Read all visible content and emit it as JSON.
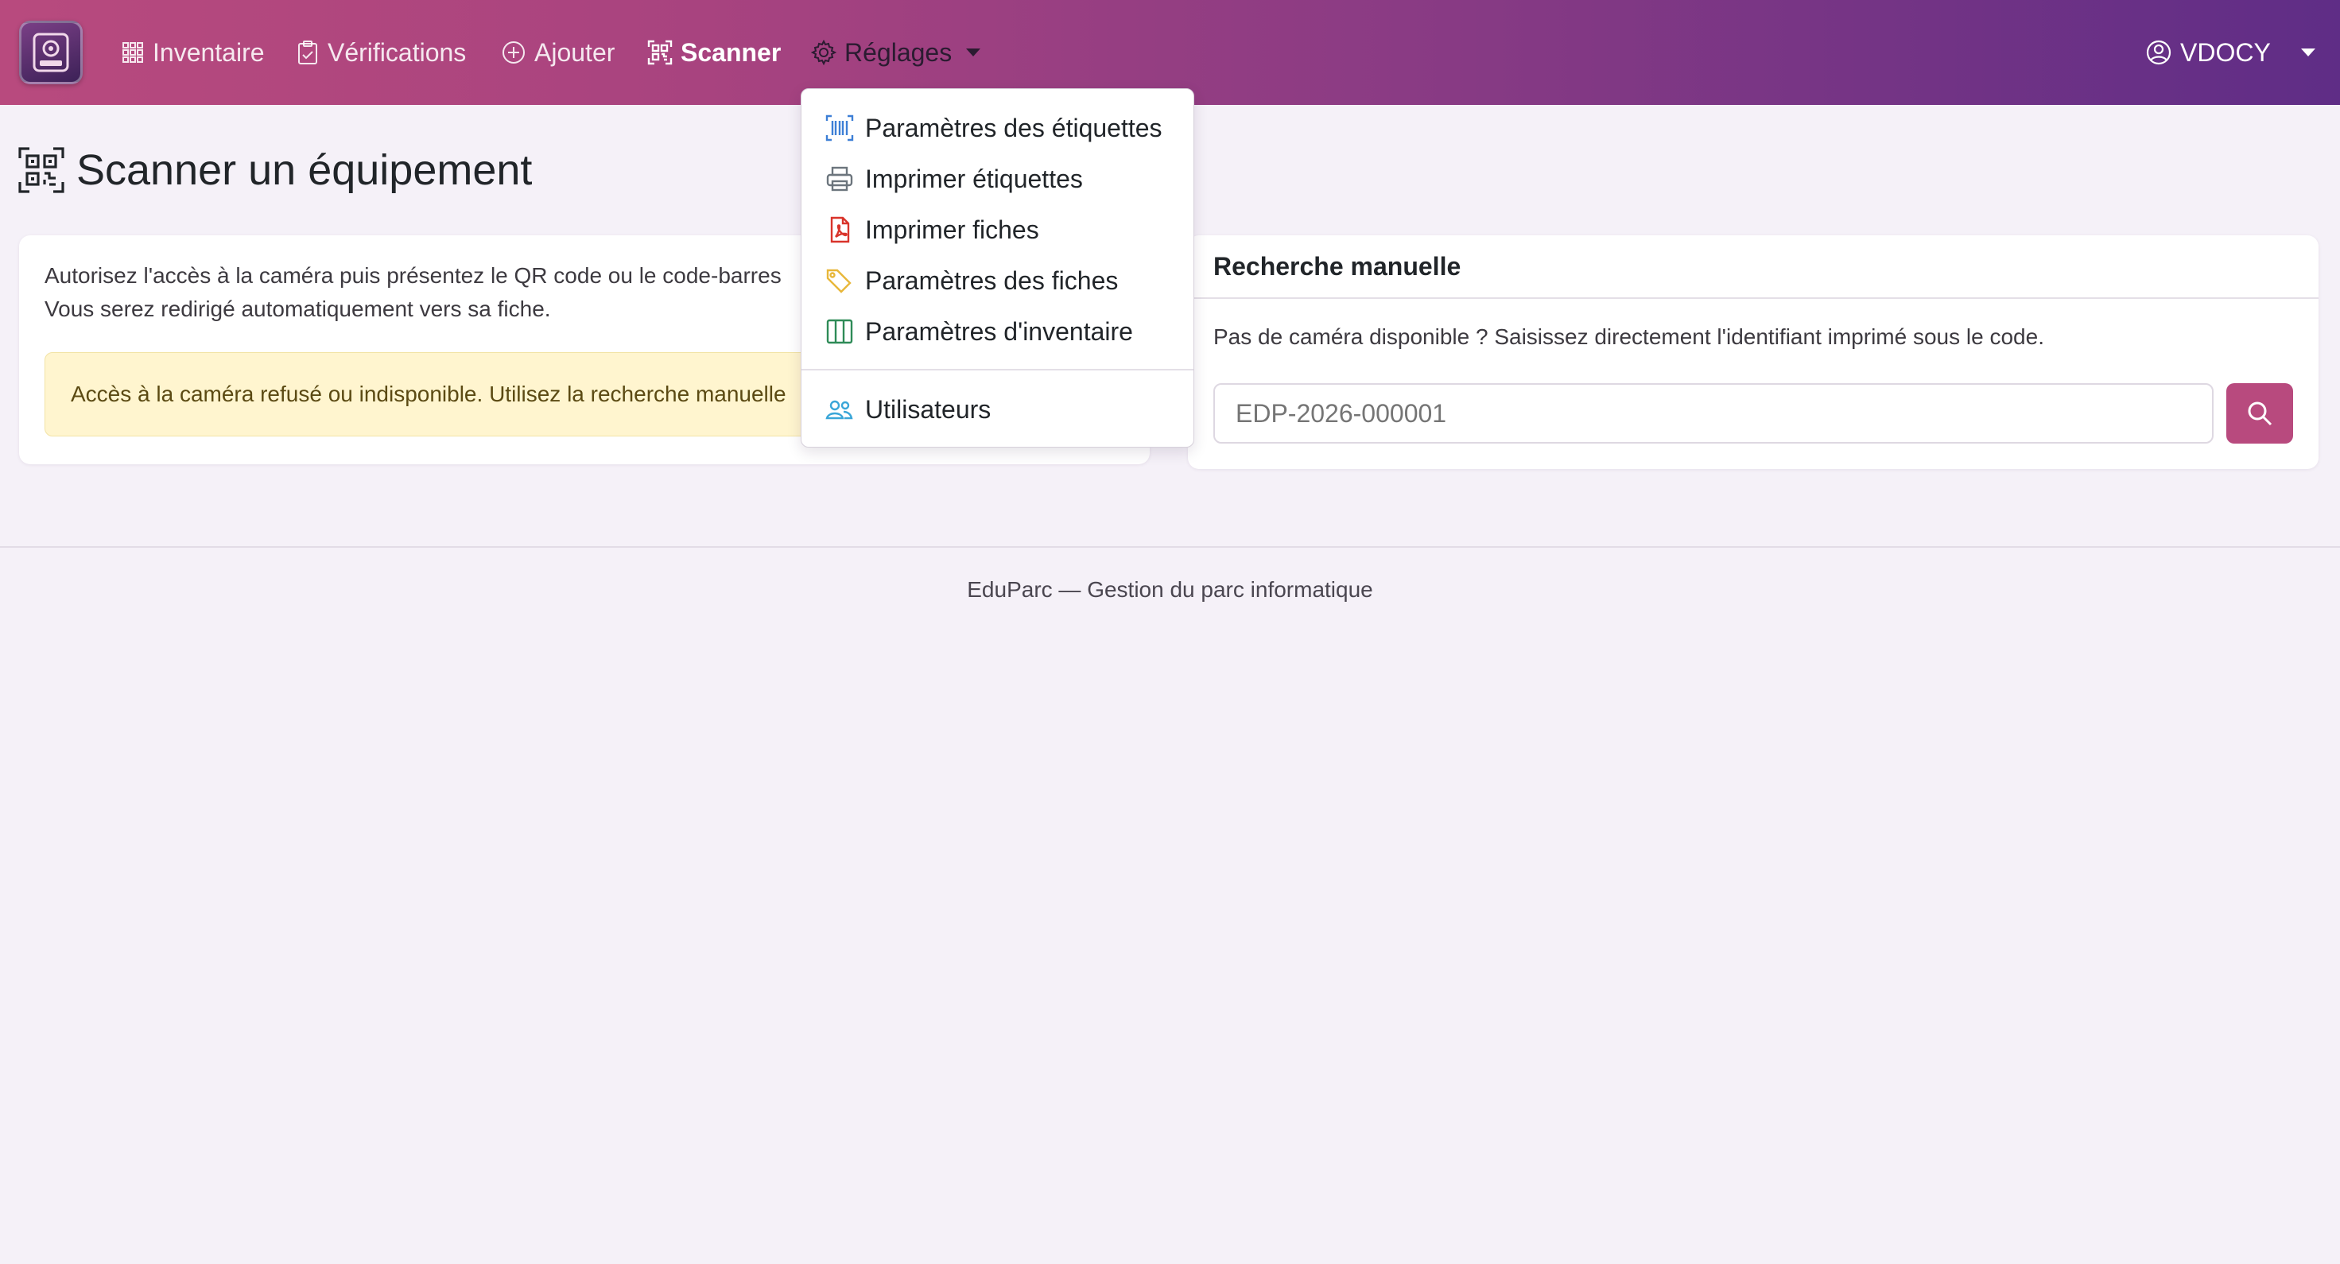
{
  "nav": {
    "items": [
      {
        "label": "Inventaire",
        "icon": "grid-icon"
      },
      {
        "label": "Vérifications",
        "icon": "clipboard-check-icon"
      },
      {
        "label": "Ajouter",
        "icon": "plus-circle-icon"
      },
      {
        "label": "Scanner",
        "icon": "qr-scan-icon",
        "active": true
      },
      {
        "label": "Réglages",
        "icon": "gear-icon",
        "open": true
      }
    ],
    "user": {
      "label": "VDOCY",
      "icon": "user-circle-icon"
    }
  },
  "settings_menu": {
    "items": [
      {
        "label": "Paramètres des étiquettes",
        "icon": "barcode-icon",
        "color": "#3d7fd6"
      },
      {
        "label": "Imprimer étiquettes",
        "icon": "printer-icon",
        "color": "#6c757d"
      },
      {
        "label": "Imprimer fiches",
        "icon": "pdf-file-icon",
        "color": "#d9342b"
      },
      {
        "label": "Paramètres des fiches",
        "icon": "tags-icon",
        "color": "#e8b73a"
      },
      {
        "label": "Paramètres d'inventaire",
        "icon": "columns-icon",
        "color": "#2e8b57"
      },
      {
        "label": "Utilisateurs",
        "icon": "people-icon",
        "color": "#3aa6d8"
      }
    ]
  },
  "page": {
    "title": "Scanner un équipement",
    "title_icon": "qr-code-icon"
  },
  "camera_card": {
    "instructions_line1": "Autorisez l'accès à la caméra puis présentez le QR code ou le code-barres",
    "instructions_line2": "Vous serez redirigé automatiquement vers sa fiche.",
    "alert_text": "Accès à la caméra refusé ou indisponible. Utilisez la recherche manuelle"
  },
  "manual_card": {
    "title": "Recherche manuelle",
    "description": "Pas de caméra disponible ? Saisissez directement l'identifiant imprimé sous le code.",
    "input_placeholder": "EDP-2026-000001",
    "search_icon": "search-icon"
  },
  "footer": {
    "text": "EduParc — Gestion du parc informatique"
  },
  "colors": {
    "accent": "#b84a7e",
    "navbar_start": "#b84a7e",
    "navbar_end": "#5f2d86",
    "alert_bg": "#fff5cf",
    "page_bg": "#f5f1f8"
  }
}
